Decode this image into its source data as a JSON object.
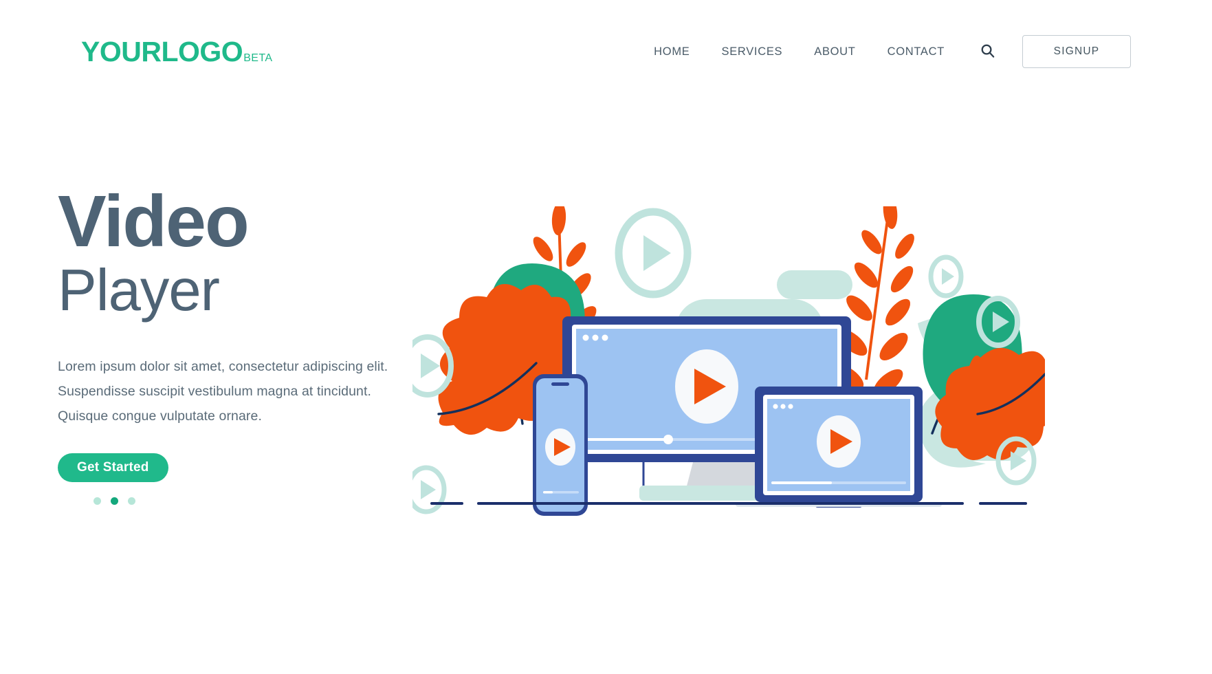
{
  "header": {
    "logo": {
      "main": "YOURLOGO",
      "sub": "BETA"
    },
    "nav": [
      {
        "label": "HOME",
        "name": "nav-link-home"
      },
      {
        "label": "SERVICES",
        "name": "nav-link-services"
      },
      {
        "label": "ABOUT",
        "name": "nav-link-about"
      },
      {
        "label": "CONTACT",
        "name": "nav-link-contact"
      }
    ],
    "search_icon": "search-icon",
    "signup_label": "SIGNUP"
  },
  "hero": {
    "title_line1": "Video",
    "title_line2": "Player",
    "paragraph": [
      "Lorem ipsum dolor sit amet, consectetur adipiscing elit.",
      "Suspendisse suscipit vestibulum magna at tincidunt.",
      "Quisque congue vulputate ornare."
    ],
    "cta_label": "Get Started",
    "carousel": {
      "count": 3,
      "active_index": 1
    }
  },
  "illustration": {
    "name": "video-player-devices-illustration",
    "devices": [
      {
        "name": "desktop-monitor",
        "play_icon": "play-icon",
        "window_dots": 3,
        "progress_percent": 34
      },
      {
        "name": "smartphone",
        "play_icon": "play-icon",
        "progress_percent": 20
      },
      {
        "name": "laptop",
        "play_icon": "play-icon",
        "window_dots": 3,
        "progress_percent": 45
      }
    ],
    "decor": [
      "play-bubble-icon",
      "orange-branch-leaf",
      "green-leaf",
      "orange-oak-leaf",
      "mint-blob"
    ]
  },
  "colors": {
    "brand_green": "#1fb98a",
    "heading_slate": "#4e6375",
    "body_slate": "#5a6b78",
    "device_navy": "#2f4795",
    "screen_blue": "#9dc3f2",
    "accent_orange": "#f0530f",
    "leaf_green": "#1fa97f",
    "mint": "#bfe5df",
    "cta_green": "#20b98b"
  }
}
